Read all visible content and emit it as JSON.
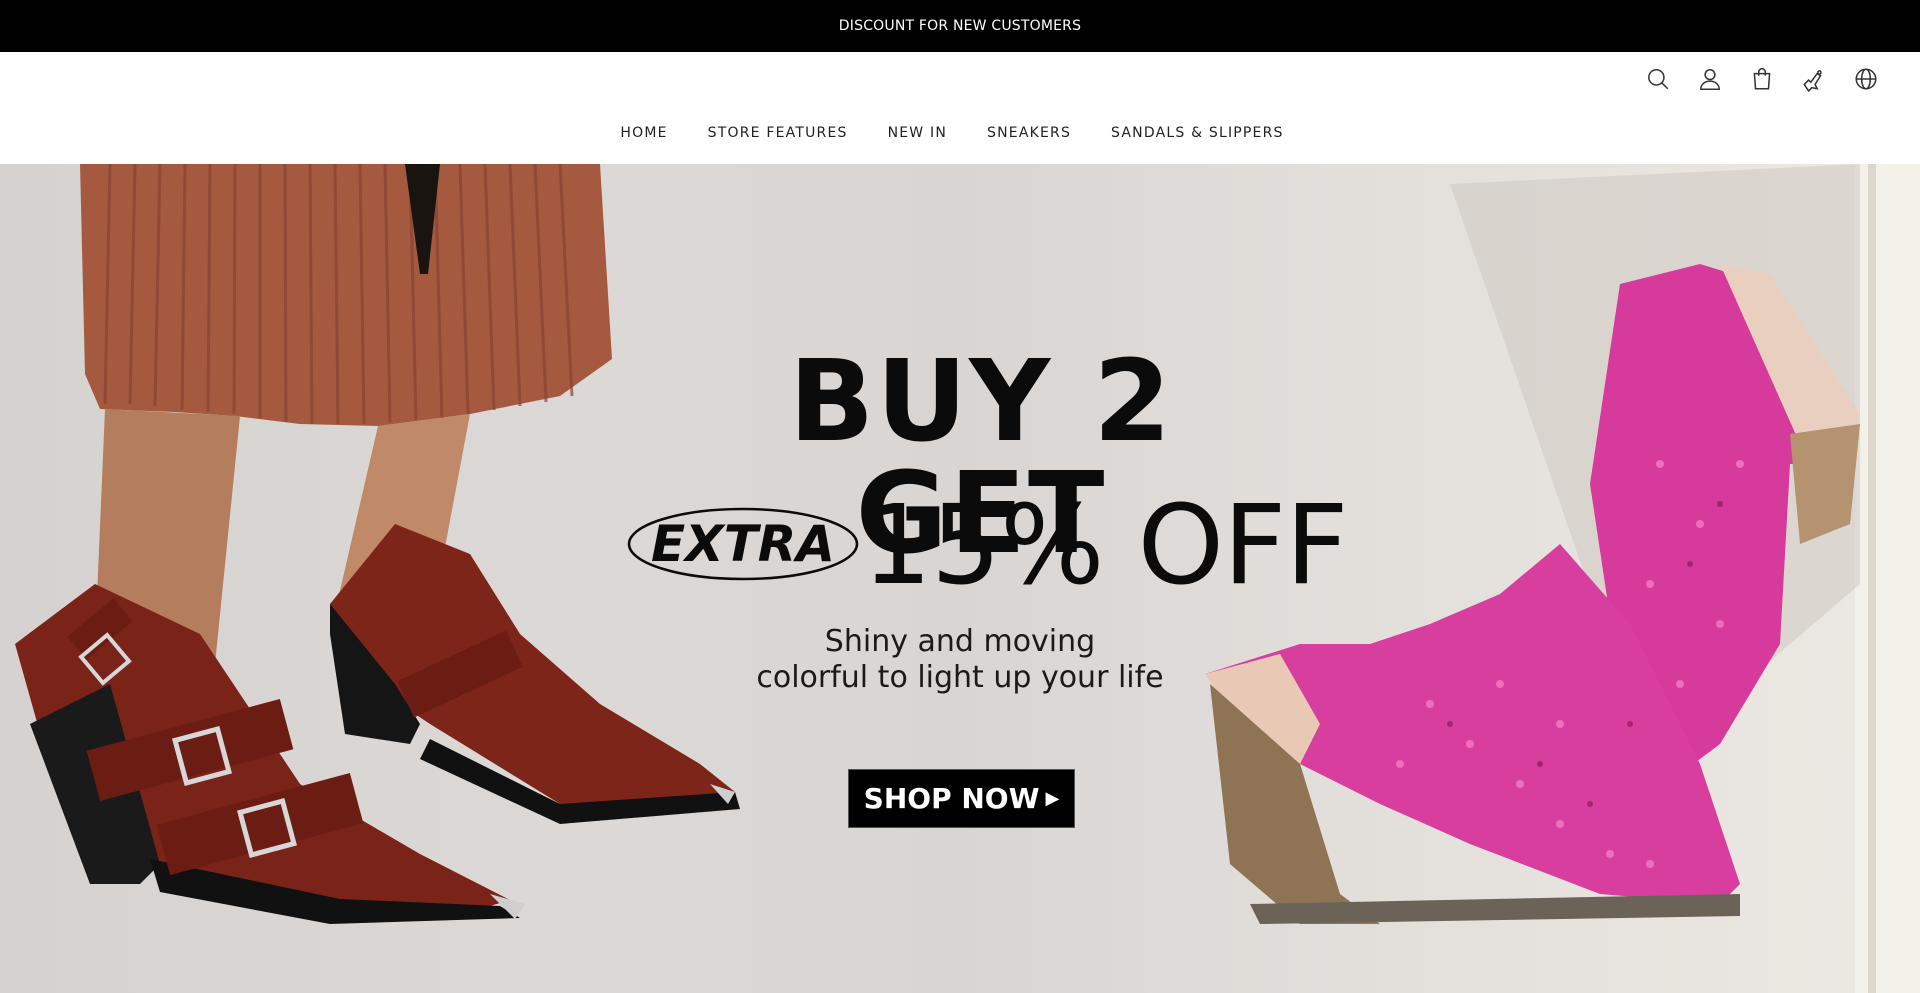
{
  "announcement": {
    "text": "DISCOUNT  FOR  NEW CUSTOMERS"
  },
  "header": {
    "icons": [
      "search-icon",
      "account-icon",
      "cart-icon",
      "wishlist-icon",
      "language-icon"
    ]
  },
  "nav": {
    "items": [
      {
        "label": "HOME"
      },
      {
        "label": "STORE  FEATURES"
      },
      {
        "label": "NEW  IN"
      },
      {
        "label": "SNEAKERS"
      },
      {
        "label": "SANDALS & SLIPPERS"
      }
    ]
  },
  "hero": {
    "title": "BUY 2 GET",
    "extra": "EXTRA",
    "discount": "15% OFF",
    "subtitle_line1": "Shiny and moving",
    "subtitle_line2": "colorful to light up your life",
    "cta_label": "SHOP NOW",
    "colors": {
      "boots_left": "#7a2318",
      "mules_right": "#d63a9a",
      "cta_bg": "#000000"
    }
  }
}
